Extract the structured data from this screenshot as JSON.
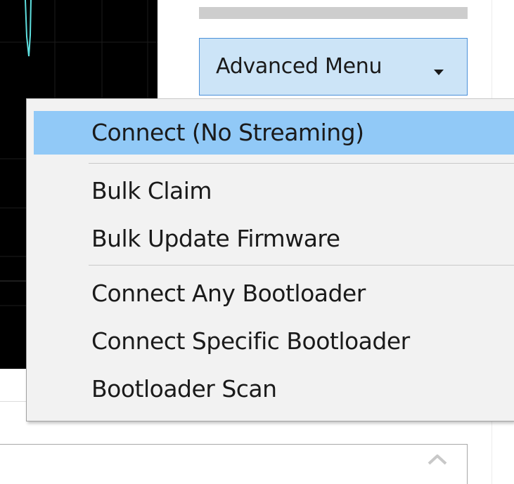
{
  "advanced_menu": {
    "button_label": "Advanced Menu",
    "caret_icon": "caret-down-icon"
  },
  "menu": {
    "items": [
      {
        "label": "Connect (No Streaming)",
        "highlighted": true
      },
      {
        "label": "Bulk Claim",
        "highlighted": false
      },
      {
        "label": "Bulk Update Firmware",
        "highlighted": false
      },
      {
        "label": "Connect Any Bootloader",
        "highlighted": false
      },
      {
        "label": "Connect Specific Bootloader",
        "highlighted": false
      },
      {
        "label": "Bootloader Scan",
        "highlighted": false
      }
    ]
  },
  "scroll": {
    "up_icon": "chevron-up-icon"
  },
  "colors": {
    "highlight": "#91c9f7",
    "button_bg": "#cce4f7",
    "button_border": "#4a90d9",
    "plot_bg": "#000000",
    "trace": "#5fe0e0",
    "menu_bg": "#f2f2f2"
  }
}
